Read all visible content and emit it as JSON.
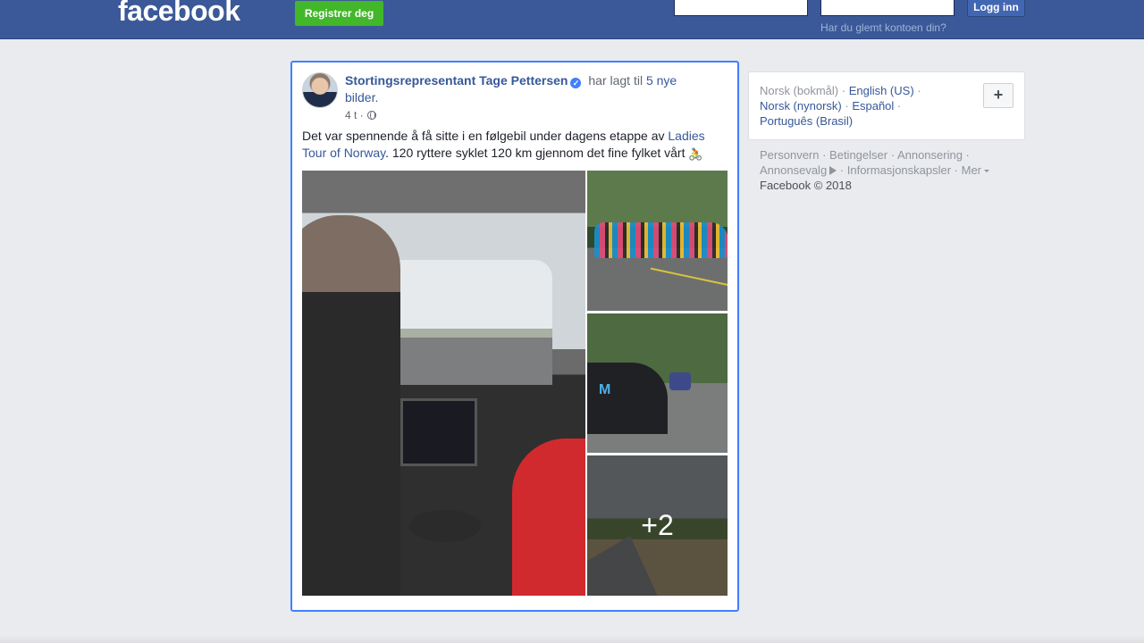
{
  "topbar": {
    "logo": "facebook",
    "register_label": "Registrer deg",
    "email_value": "",
    "password_value": "",
    "login_label": "Logg inn",
    "forgot_label": "Har du glemt kontoen din?"
  },
  "post": {
    "author": "Stortingsrepresentant Tage Pettersen",
    "action_text": "har lagt til",
    "photos_link": "5 nye bilder.",
    "timestamp": "4 t ·",
    "text_before": "Det var spennende å få sitte i en følgebil under dagens etappe av ",
    "text_link": "Ladies Tour of Norway",
    "text_after": ". 120 ryttere syklet 120 km gjennom det fine fylket vårt ",
    "bike_emoji": "🚴",
    "more_photos": "+2"
  },
  "languages": {
    "current": "Norsk (bokmål)",
    "links": [
      "English (US)",
      "Norsk (nynorsk)",
      "Español",
      "Português (Brasil)"
    ],
    "add_label": "+"
  },
  "footer": {
    "links": [
      "Personvern",
      "Betingelser",
      "Annonsering",
      "Annonsevalg",
      "Informasjonskapsler",
      "Mer"
    ],
    "copyright": "Facebook © 2018"
  },
  "colors": {
    "brand": "#3b5998",
    "link": "#365899",
    "register_green": "#42b72a",
    "focus_border": "#4080ff"
  }
}
